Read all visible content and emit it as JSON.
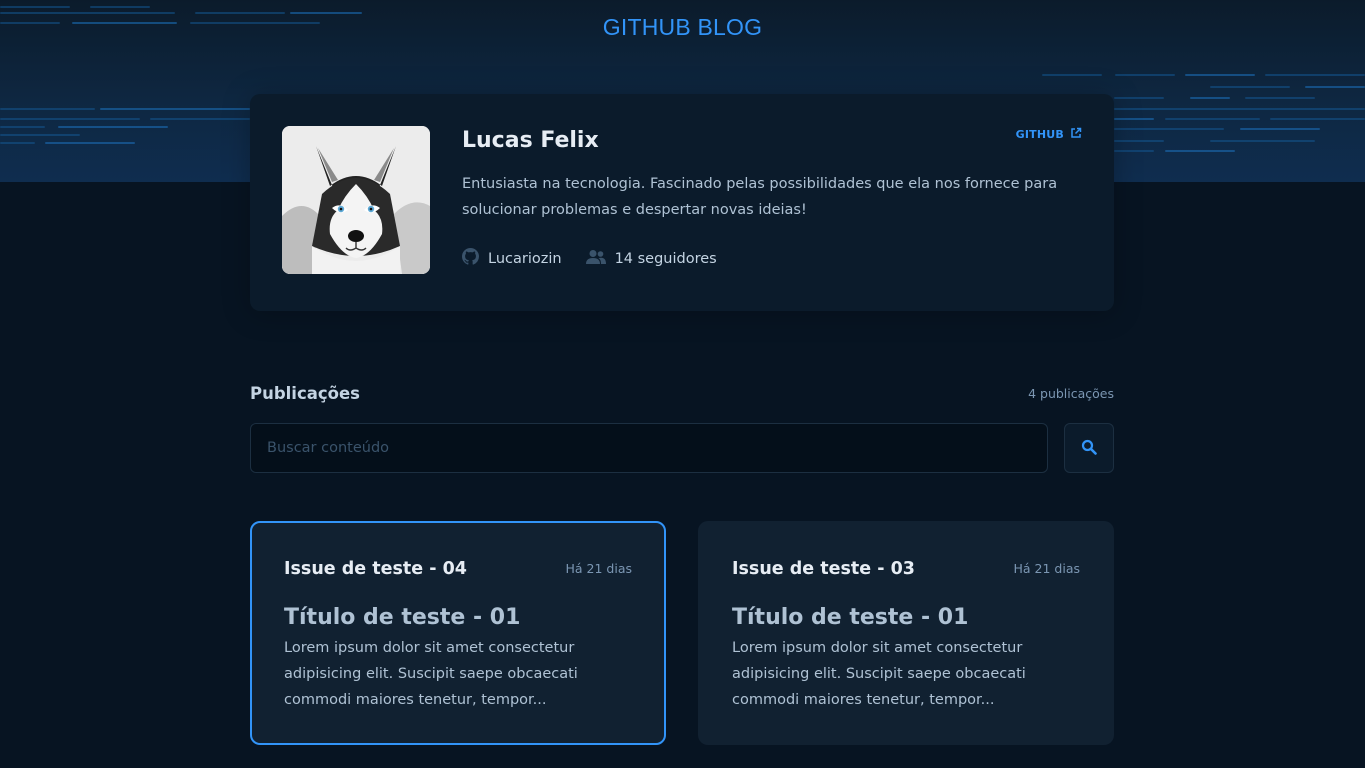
{
  "header": {
    "brand": "GITHUB BLOG"
  },
  "profile": {
    "name": "Lucas Felix",
    "github_label": "GITHUB",
    "bio": "Entusiasta na tecnologia. Fascinado pelas possibilidades que ela nos fornece para solucionar problemas e despertar novas ideias!",
    "username": "Lucariozin",
    "followers": "14 seguidores",
    "avatar_alt": "husky-dog-photo"
  },
  "publications": {
    "title": "Publicações",
    "count": "4 publicações",
    "search_placeholder": "Buscar conteúdo"
  },
  "posts": [
    {
      "issue": "Issue de teste - 04",
      "date": "Há 21 dias",
      "title": "Título de teste - 01",
      "excerpt": "Lorem ipsum dolor sit amet consectetur adipisicing elit. Suscipit saepe obcaecati commodi maiores tenetur, tempor..."
    },
    {
      "issue": "Issue de teste - 03",
      "date": "Há 21 dias",
      "title": "Título de teste - 01",
      "excerpt": "Lorem ipsum dolor sit amet consectetur adipisicing elit. Suscipit saepe obcaecati commodi maiores tenetur, tempor..."
    }
  ],
  "colors": {
    "accent": "#3294f8",
    "background": "#071422",
    "profile_card": "#0b1b2b",
    "post_card": "#112131"
  },
  "icons": {
    "external_link": "external-link-icon",
    "github": "github-icon",
    "followers": "users-icon",
    "search": "search-icon"
  }
}
